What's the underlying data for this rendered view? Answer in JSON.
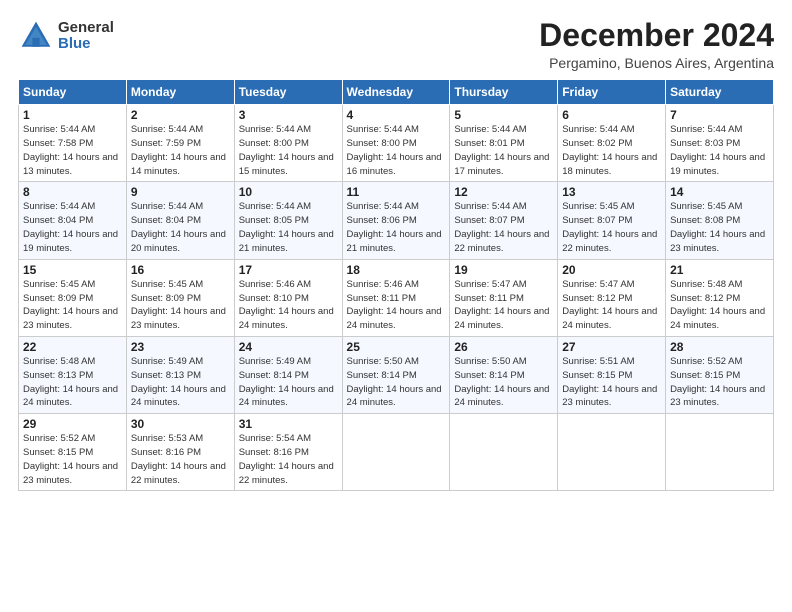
{
  "logo": {
    "general": "General",
    "blue": "Blue"
  },
  "title": "December 2024",
  "subtitle": "Pergamino, Buenos Aires, Argentina",
  "weekdays": [
    "Sunday",
    "Monday",
    "Tuesday",
    "Wednesday",
    "Thursday",
    "Friday",
    "Saturday"
  ],
  "weeks": [
    [
      {
        "day": "1",
        "sunrise": "5:44 AM",
        "sunset": "7:58 PM",
        "daylight": "14 hours and 13 minutes."
      },
      {
        "day": "2",
        "sunrise": "5:44 AM",
        "sunset": "7:59 PM",
        "daylight": "14 hours and 14 minutes."
      },
      {
        "day": "3",
        "sunrise": "5:44 AM",
        "sunset": "8:00 PM",
        "daylight": "14 hours and 15 minutes."
      },
      {
        "day": "4",
        "sunrise": "5:44 AM",
        "sunset": "8:00 PM",
        "daylight": "14 hours and 16 minutes."
      },
      {
        "day": "5",
        "sunrise": "5:44 AM",
        "sunset": "8:01 PM",
        "daylight": "14 hours and 17 minutes."
      },
      {
        "day": "6",
        "sunrise": "5:44 AM",
        "sunset": "8:02 PM",
        "daylight": "14 hours and 18 minutes."
      },
      {
        "day": "7",
        "sunrise": "5:44 AM",
        "sunset": "8:03 PM",
        "daylight": "14 hours and 19 minutes."
      }
    ],
    [
      {
        "day": "8",
        "sunrise": "5:44 AM",
        "sunset": "8:04 PM",
        "daylight": "14 hours and 19 minutes."
      },
      {
        "day": "9",
        "sunrise": "5:44 AM",
        "sunset": "8:04 PM",
        "daylight": "14 hours and 20 minutes."
      },
      {
        "day": "10",
        "sunrise": "5:44 AM",
        "sunset": "8:05 PM",
        "daylight": "14 hours and 21 minutes."
      },
      {
        "day": "11",
        "sunrise": "5:44 AM",
        "sunset": "8:06 PM",
        "daylight": "14 hours and 21 minutes."
      },
      {
        "day": "12",
        "sunrise": "5:44 AM",
        "sunset": "8:07 PM",
        "daylight": "14 hours and 22 minutes."
      },
      {
        "day": "13",
        "sunrise": "5:45 AM",
        "sunset": "8:07 PM",
        "daylight": "14 hours and 22 minutes."
      },
      {
        "day": "14",
        "sunrise": "5:45 AM",
        "sunset": "8:08 PM",
        "daylight": "14 hours and 23 minutes."
      }
    ],
    [
      {
        "day": "15",
        "sunrise": "5:45 AM",
        "sunset": "8:09 PM",
        "daylight": "14 hours and 23 minutes."
      },
      {
        "day": "16",
        "sunrise": "5:45 AM",
        "sunset": "8:09 PM",
        "daylight": "14 hours and 23 minutes."
      },
      {
        "day": "17",
        "sunrise": "5:46 AM",
        "sunset": "8:10 PM",
        "daylight": "14 hours and 24 minutes."
      },
      {
        "day": "18",
        "sunrise": "5:46 AM",
        "sunset": "8:11 PM",
        "daylight": "14 hours and 24 minutes."
      },
      {
        "day": "19",
        "sunrise": "5:47 AM",
        "sunset": "8:11 PM",
        "daylight": "14 hours and 24 minutes."
      },
      {
        "day": "20",
        "sunrise": "5:47 AM",
        "sunset": "8:12 PM",
        "daylight": "14 hours and 24 minutes."
      },
      {
        "day": "21",
        "sunrise": "5:48 AM",
        "sunset": "8:12 PM",
        "daylight": "14 hours and 24 minutes."
      }
    ],
    [
      {
        "day": "22",
        "sunrise": "5:48 AM",
        "sunset": "8:13 PM",
        "daylight": "14 hours and 24 minutes."
      },
      {
        "day": "23",
        "sunrise": "5:49 AM",
        "sunset": "8:13 PM",
        "daylight": "14 hours and 24 minutes."
      },
      {
        "day": "24",
        "sunrise": "5:49 AM",
        "sunset": "8:14 PM",
        "daylight": "14 hours and 24 minutes."
      },
      {
        "day": "25",
        "sunrise": "5:50 AM",
        "sunset": "8:14 PM",
        "daylight": "14 hours and 24 minutes."
      },
      {
        "day": "26",
        "sunrise": "5:50 AM",
        "sunset": "8:14 PM",
        "daylight": "14 hours and 24 minutes."
      },
      {
        "day": "27",
        "sunrise": "5:51 AM",
        "sunset": "8:15 PM",
        "daylight": "14 hours and 23 minutes."
      },
      {
        "day": "28",
        "sunrise": "5:52 AM",
        "sunset": "8:15 PM",
        "daylight": "14 hours and 23 minutes."
      }
    ],
    [
      {
        "day": "29",
        "sunrise": "5:52 AM",
        "sunset": "8:15 PM",
        "daylight": "14 hours and 23 minutes."
      },
      {
        "day": "30",
        "sunrise": "5:53 AM",
        "sunset": "8:16 PM",
        "daylight": "14 hours and 22 minutes."
      },
      {
        "day": "31",
        "sunrise": "5:54 AM",
        "sunset": "8:16 PM",
        "daylight": "14 hours and 22 minutes."
      },
      null,
      null,
      null,
      null
    ]
  ]
}
